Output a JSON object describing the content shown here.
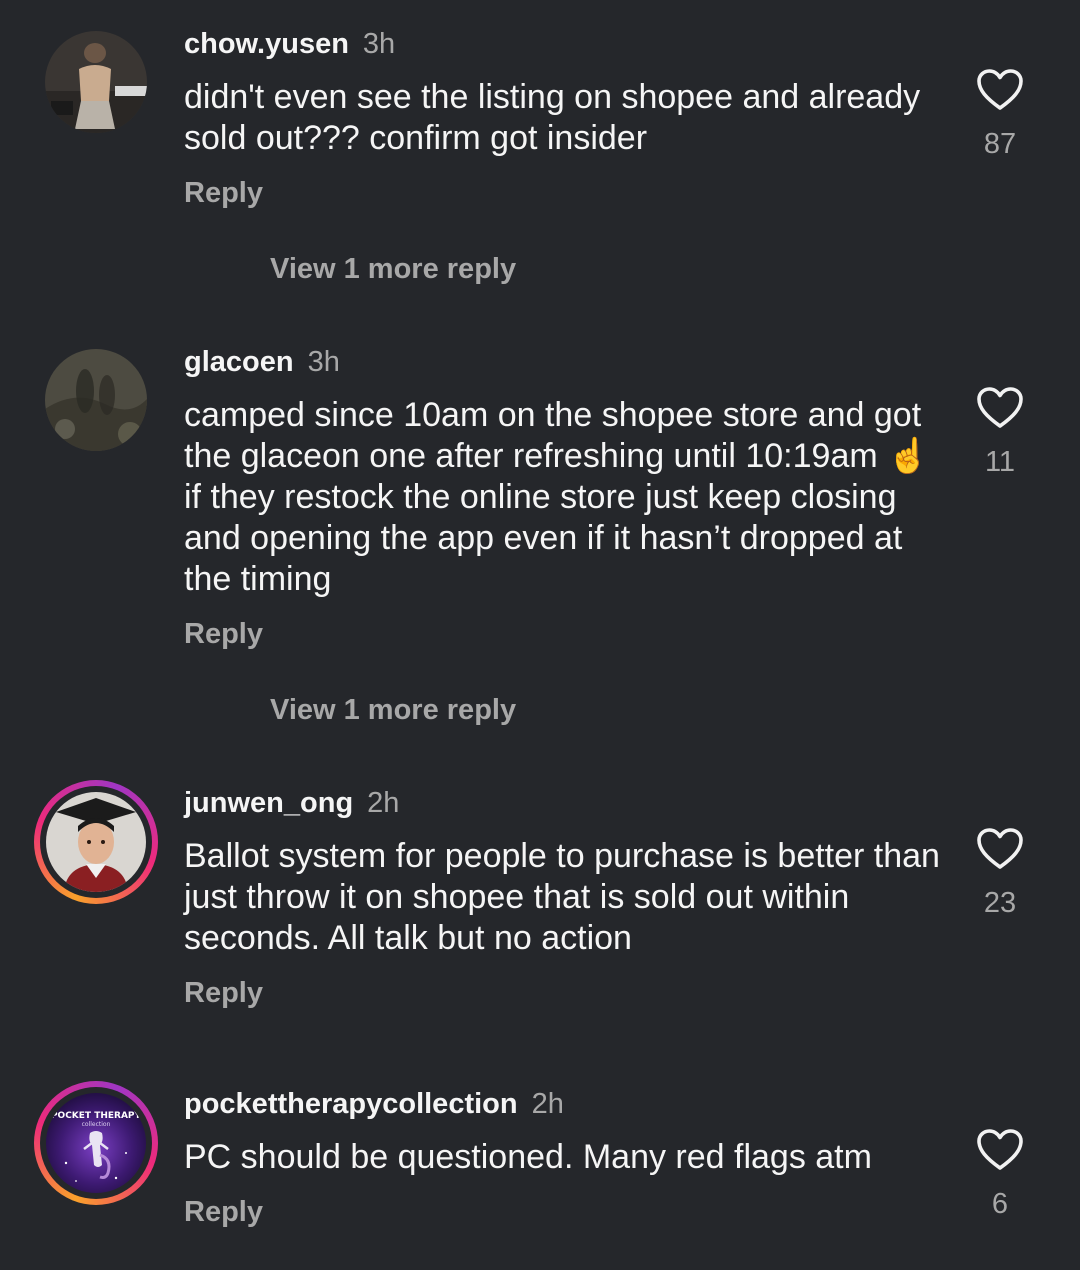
{
  "comments": [
    {
      "username": "chow.yusen",
      "time": "3h",
      "text": "didn't even see the listing on shopee and already sold out??? confirm got insider",
      "reply_label": "Reply",
      "likes": "87",
      "view_more": "View 1 more reply",
      "avatar": "photo-person-avatar"
    },
    {
      "username": "glacoen",
      "time": "3h",
      "text": "camped since 10am on the shopee store and got the glaceon one after refreshing until 10:19am ☝️ if they restock the online store just keep closing and opening the app even if it hasn’t dropped at the timing",
      "reply_label": "Reply",
      "likes": "11",
      "view_more": "View 1 more reply",
      "avatar": "photo-shadow-avatar"
    },
    {
      "username": "junwen_ong",
      "time": "2h",
      "text": "Ballot system for people to purchase is better than just throw it on shopee that is sold out within seconds. All talk but no action",
      "reply_label": "Reply",
      "likes": "23",
      "avatar": "photo-child-graduate-avatar"
    },
    {
      "username": "pockettherapycollection",
      "time": "2h",
      "text": "PC should be questioned. Many red flags atm",
      "reply_label": "Reply",
      "likes": "6",
      "avatar": "pocket-therapy-logo-avatar",
      "avatar_logo_text": "POCKET THERAPY",
      "avatar_logo_subtext": "collection"
    }
  ],
  "icons": {
    "like": "heart-outline-icon"
  },
  "colors": {
    "background": "#25272b",
    "primary_text": "#f5f5f5",
    "secondary_text": "#a8a8a8",
    "story_ring_start": "#f9a12b",
    "story_ring_end": "#a036c4"
  }
}
